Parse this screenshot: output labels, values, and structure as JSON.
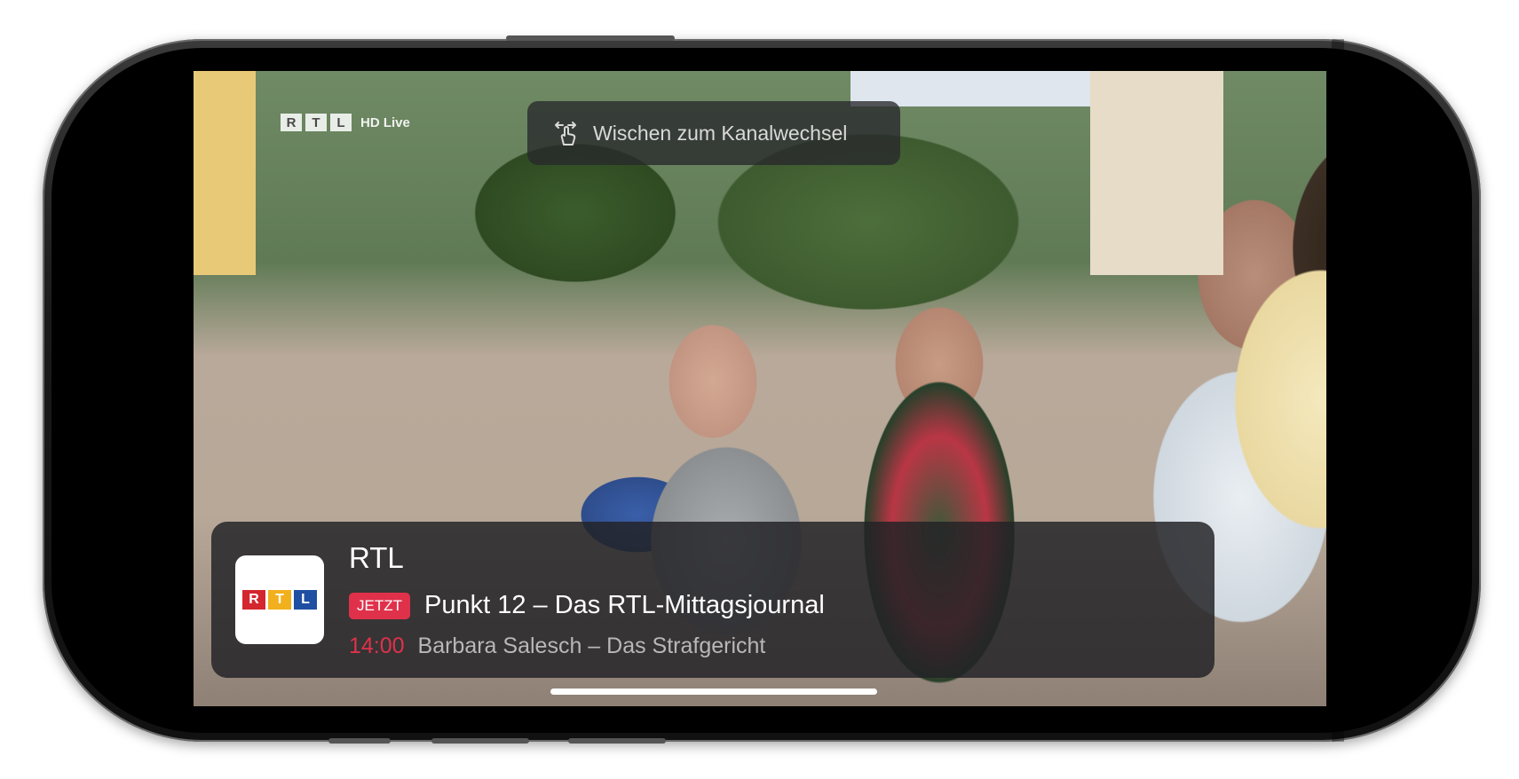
{
  "overlay": {
    "watermark": {
      "letters": [
        "R",
        "T",
        "L"
      ],
      "suffix": "HD Live"
    },
    "swipe_hint": {
      "icon": "swipe-hand-icon",
      "text": "Wischen zum Kanalwechsel"
    }
  },
  "info_panel": {
    "channel_logo": {
      "letters": [
        "R",
        "T",
        "L"
      ],
      "colors": [
        "#d4262f",
        "#f2b01e",
        "#1f4fa3"
      ]
    },
    "channel_name": "RTL",
    "now": {
      "badge": "JETZT",
      "title": "Punkt 12 – Das RTL-Mittagsjournal"
    },
    "next": {
      "time": "14:00",
      "title": "Barbara Salesch – Das Strafgericht"
    }
  },
  "colors": {
    "accent": "#e0314b",
    "panel_bg": "#232326"
  }
}
